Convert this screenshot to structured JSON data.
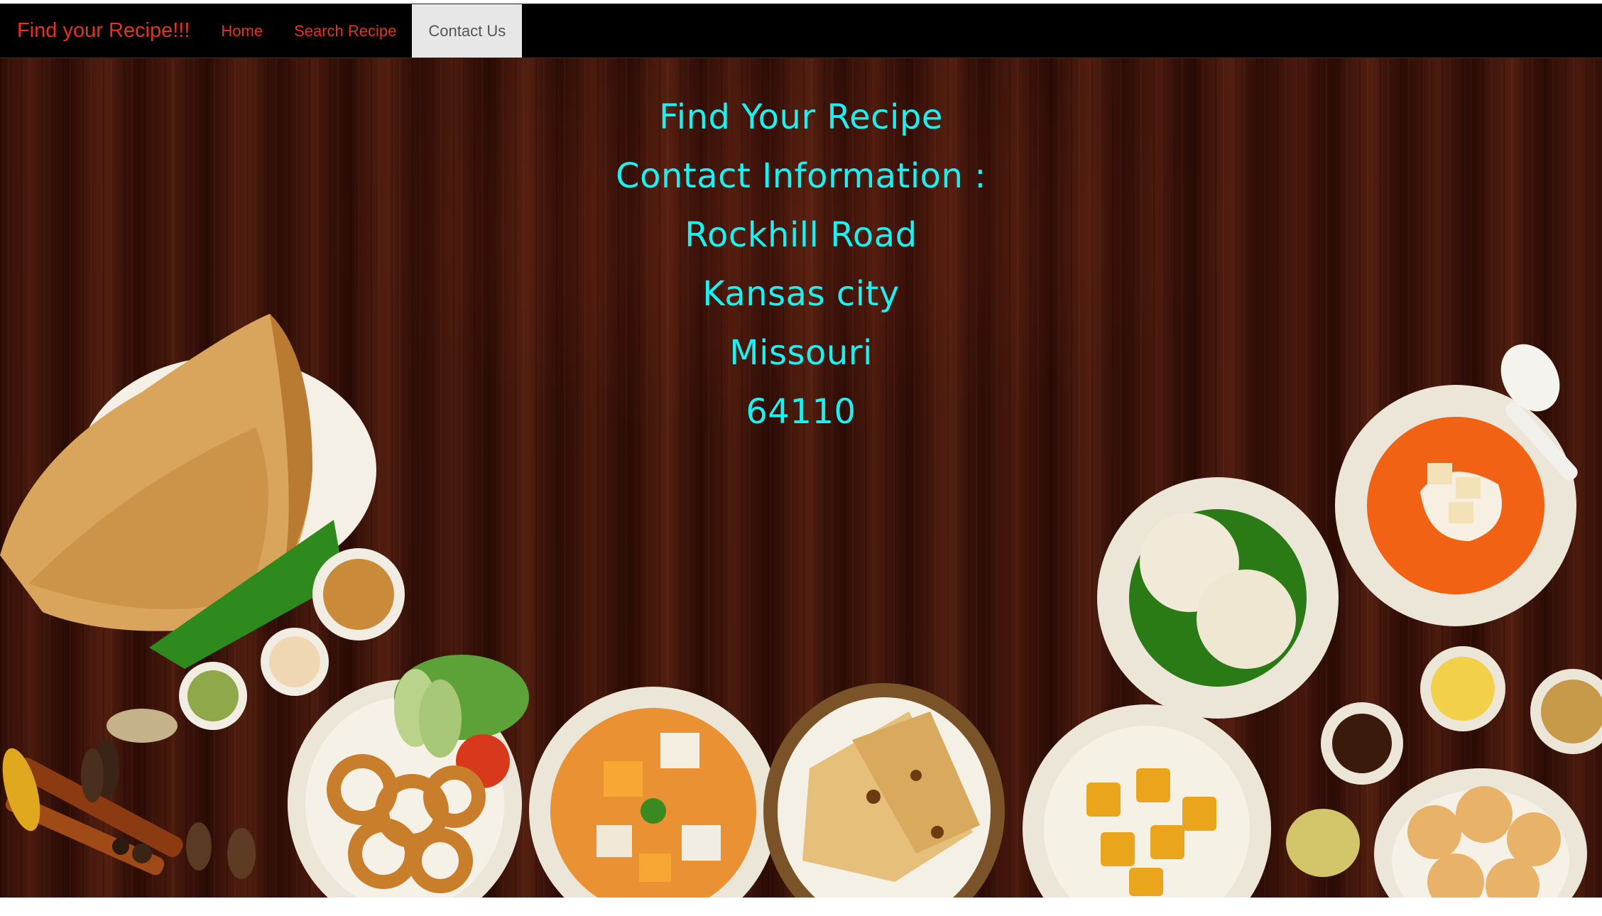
{
  "navbar": {
    "brand": "Find your Recipe!!!",
    "items": [
      {
        "label": "Home",
        "active": false
      },
      {
        "label": "Search Recipe",
        "active": false
      },
      {
        "label": "Contact Us",
        "active": true
      }
    ],
    "colors": {
      "background": "#000000",
      "link": "#e8321e",
      "active_bg": "#e7e7e7"
    }
  },
  "contact": {
    "lines": [
      "Find Your Recipe",
      "Contact Information :",
      "Rockhill Road",
      "Kansas city",
      "Missouri",
      "64110"
    ],
    "color": "#19f2f2"
  },
  "background": {
    "description_icons": [
      "dosa-icon",
      "chutney-bowl-icon",
      "onion-rings-plate-icon",
      "paneer-curry-bowl-icon",
      "naan-basket-icon",
      "potato-curry-bowl-icon",
      "idli-plate-icon",
      "tomato-soup-bowl-icon",
      "spoon-icon",
      "puri-plate-icon",
      "spices-icon"
    ]
  }
}
